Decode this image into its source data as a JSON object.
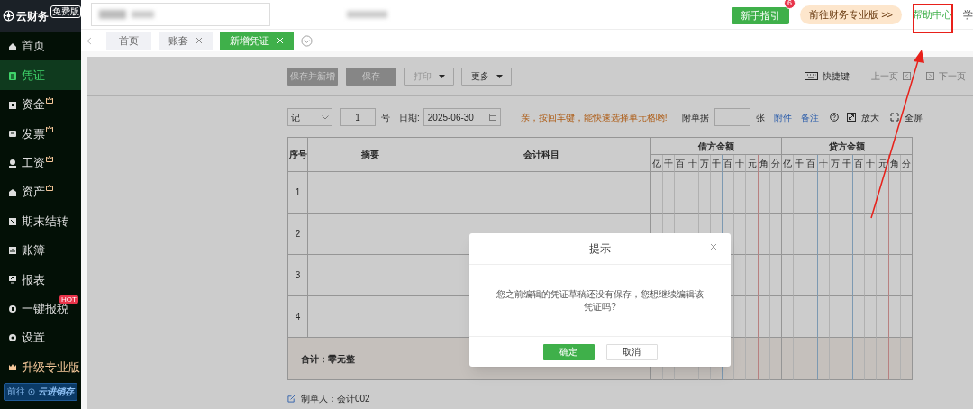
{
  "app": {
    "logo_text": "云财务",
    "edition_badge": "免费版"
  },
  "sidebar": {
    "items": [
      {
        "label": "首页",
        "selected": false,
        "crown": false
      },
      {
        "label": "凭证",
        "selected": true,
        "crown": false
      },
      {
        "label": "资金",
        "selected": false,
        "crown": true
      },
      {
        "label": "发票",
        "selected": false,
        "crown": true
      },
      {
        "label": "工资",
        "selected": false,
        "crown": true
      },
      {
        "label": "资产",
        "selected": false,
        "crown": true
      },
      {
        "label": "期末结转",
        "selected": false,
        "crown": false
      },
      {
        "label": "账簿",
        "selected": false,
        "crown": false
      },
      {
        "label": "报表",
        "selected": false,
        "crown": false
      },
      {
        "label": "一键报税",
        "selected": false,
        "crown": false,
        "badge": "HOT"
      },
      {
        "label": "设置",
        "selected": false,
        "crown": false
      },
      {
        "label": "升级专业版",
        "selected": false,
        "crown": false,
        "kind": "upgrade"
      }
    ],
    "promo_button": {
      "prefix": "前往",
      "brand": "云进销存"
    }
  },
  "top_bar": {
    "guide_button": {
      "label": "新手指引",
      "badge": "6"
    },
    "pro_button": "前往财务专业版 >>",
    "help_link": {
      "label": "帮助中心",
      "highlighted": true
    },
    "cut_link": "学"
  },
  "tabs": [
    {
      "label": "首页",
      "closable": false,
      "selected": false
    },
    {
      "label": "账套",
      "closable": true,
      "selected": false
    },
    {
      "label": "新增凭证",
      "closable": true,
      "selected": true
    }
  ],
  "toolbar": {
    "buttons": [
      {
        "label": "保存并新增",
        "kind": "button"
      },
      {
        "label": "保存",
        "kind": "button"
      },
      {
        "label": "打印",
        "kind": "dropdown",
        "disabled": true
      },
      {
        "label": "更多",
        "kind": "dropdown",
        "disabled": false
      }
    ],
    "shortcut": "快捷键",
    "prev": "上一页",
    "next": "下一页"
  },
  "form": {
    "voucher_type": "记",
    "number": "1",
    "number_suffix": "号",
    "date_label": "日期:",
    "date": "2025-06-30",
    "hint": "亲，按回车键，能快速选择单元格哟!",
    "attach_label": "附单据",
    "attach_unit": "张",
    "links": [
      "附件",
      "备注"
    ],
    "zoom": "放大",
    "fullscreen": "全屏"
  },
  "table": {
    "columns": [
      "序号",
      "摘要",
      "会计科目"
    ],
    "debit_header": "借方金额",
    "credit_header": "贷方金额",
    "debit_units": [
      "亿",
      "千",
      "百",
      "十",
      "万",
      "千",
      "百",
      "十",
      "元",
      "角",
      "分"
    ],
    "credit_units": [
      "亿",
      "千",
      "百",
      "十",
      "万",
      "千",
      "百",
      "十",
      "元",
      "角",
      "分"
    ],
    "rows": [
      "1",
      "2",
      "3",
      "4"
    ],
    "total": "合计：零元整"
  },
  "footer": {
    "creator": "制单人：会计002"
  },
  "dialog": {
    "title": "提示",
    "message": "您之前编辑的凭证草稿还没有保存，您想继续编辑该凭证吗?",
    "buttons": [
      {
        "label": "确定",
        "primary": true
      },
      {
        "label": "取消",
        "primary": false
      }
    ]
  }
}
